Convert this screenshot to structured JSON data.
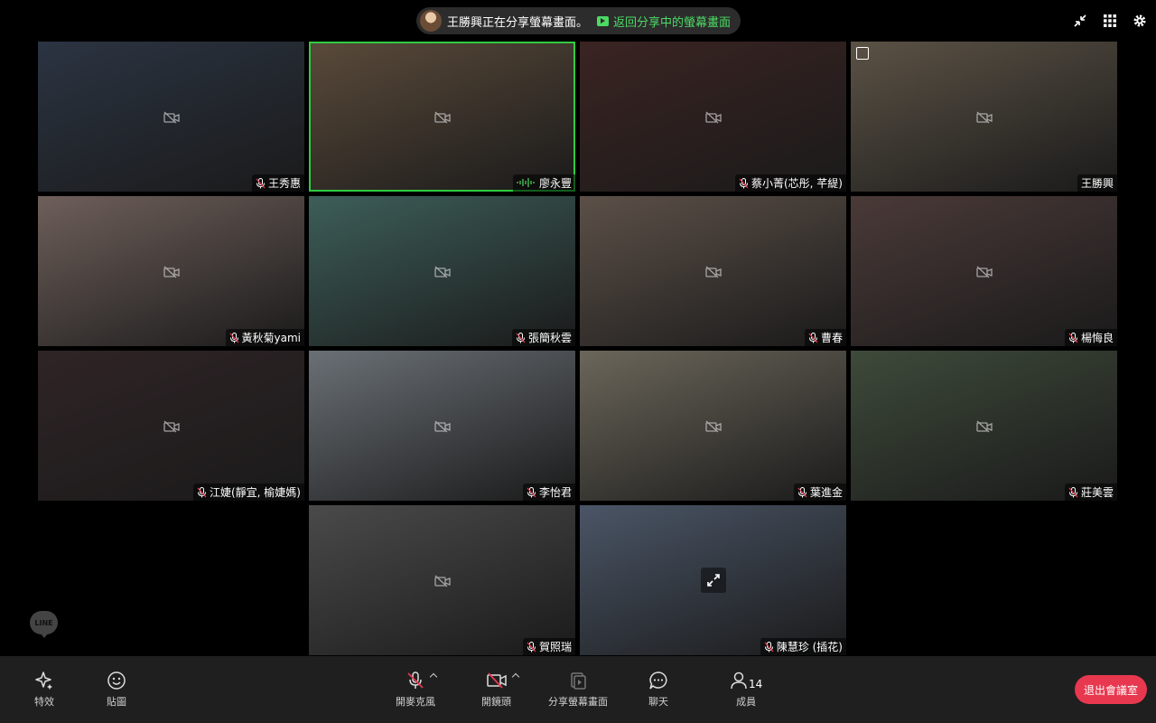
{
  "banner": {
    "presenter": "王勝興",
    "message": "正在分享螢幕畫面。",
    "return_link": "返回分享中的螢幕畫面"
  },
  "top_icons": [
    "collapse-icon",
    "grid-layout-icon",
    "settings-gear-icon"
  ],
  "participants": [
    {
      "name": "王秀惠",
      "muted": true,
      "camera_off": true,
      "bg": "#2b3442"
    },
    {
      "name": "廖永豐",
      "muted": false,
      "speaking": true,
      "camera_off": true,
      "active": true,
      "bg": "#5a4a3a"
    },
    {
      "name": "蔡小菁(芯彤, 芊緹)",
      "muted": true,
      "camera_off": true,
      "bg": "#3a2422"
    },
    {
      "name": "王勝興",
      "muted": false,
      "camera_off": true,
      "pinned": true,
      "bg": "#5b5245"
    },
    {
      "name": "黃秋菊yami",
      "muted": true,
      "camera_off": true,
      "bg": "#6e5f5a"
    },
    {
      "name": "張簡秋雲",
      "muted": true,
      "camera_off": true,
      "bg": "#3d5e59"
    },
    {
      "name": "曹春",
      "muted": true,
      "camera_off": true,
      "bg": "#5c5048"
    },
    {
      "name": "楊悔良",
      "muted": true,
      "camera_off": true,
      "bg": "#4a3a38"
    },
    {
      "name": "江婕(靜宜, 榆婕媽)",
      "muted": true,
      "camera_off": true,
      "bg": "#2f2426"
    },
    {
      "name": "李怡君",
      "muted": true,
      "camera_off": true,
      "bg": "#6a7076"
    },
    {
      "name": "葉進金",
      "muted": true,
      "camera_off": true,
      "bg": "#6b665a"
    },
    {
      "name": "莊美雲",
      "muted": true,
      "camera_off": true,
      "bg": "#3e4a3a"
    },
    {
      "name": "賀照瑞",
      "muted": true,
      "camera_off": true,
      "bg": "#4a4a4a"
    },
    {
      "name": "陳慧珍 (插花)",
      "muted": true,
      "camera_off": false,
      "expand": true,
      "bg": "#4a5566"
    }
  ],
  "line_logo": "LINE",
  "toolbar": {
    "effects": "特效",
    "stickers": "貼圖",
    "mic": "開麥克風",
    "camera": "開鏡頭",
    "share": "分享螢幕畫面",
    "chat": "聊天",
    "members": "成員",
    "member_count": "14",
    "leave": "退出會議室"
  }
}
